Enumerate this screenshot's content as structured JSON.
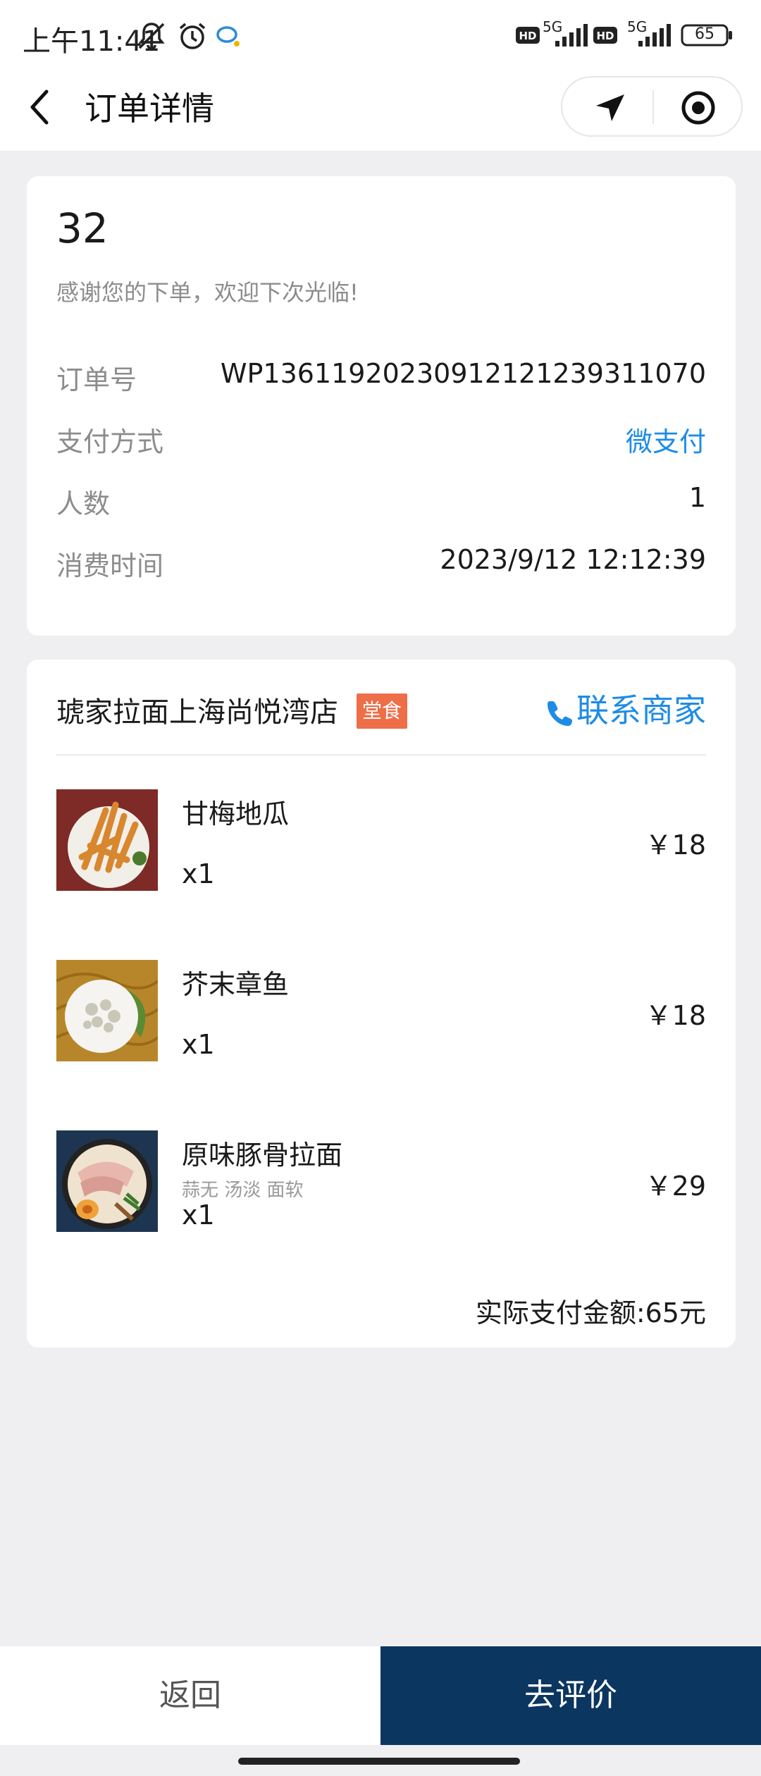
{
  "status_bar": {
    "time": "上午11:41",
    "network_1": "5G",
    "network_2": "5G",
    "battery": "65",
    "icons": [
      "mute-icon",
      "alarm-icon",
      "chat-bubble-icon",
      "hd-icon",
      "signal-icon",
      "battery-icon"
    ]
  },
  "nav": {
    "title": "订单详情",
    "back_icon": "chevron-left-icon",
    "capsule_icons": [
      "navigation-arrow-icon",
      "target-icon"
    ]
  },
  "order": {
    "number": "32",
    "thanks": "感谢您的下单，欢迎下次光临!",
    "rows": [
      {
        "label": "订单号",
        "value": "WP136119202309121212393110​70"
      },
      {
        "label": "支付方式",
        "value": "微支付"
      },
      {
        "label": "人数",
        "value": "1"
      },
      {
        "label": "消费时间",
        "value": "2023/9/12 12:12:39"
      }
    ]
  },
  "shop": {
    "name": "琥家拉面上海尚悦湾店",
    "tag": "堂食",
    "contact_label": "联系商家",
    "contact_icon": "phone-icon",
    "items": [
      {
        "name": "甘梅地瓜",
        "options": "",
        "qty": "x1",
        "price": "￥18"
      },
      {
        "name": "芥末章鱼",
        "options": "",
        "qty": "x1",
        "price": "￥18"
      },
      {
        "name": "原味豚骨拉面",
        "options": "蒜无 汤淡 面软",
        "qty": "x1",
        "price": "￥29"
      }
    ],
    "total": "实际支付金额:65元"
  },
  "footer": {
    "back_label": "返回",
    "review_label": "去评价"
  },
  "colors": {
    "accent_blue": "#1e8ce6",
    "tag_orange": "#ee6e48",
    "primary_button": "#0b3660",
    "page_bg": "#efeff1"
  }
}
